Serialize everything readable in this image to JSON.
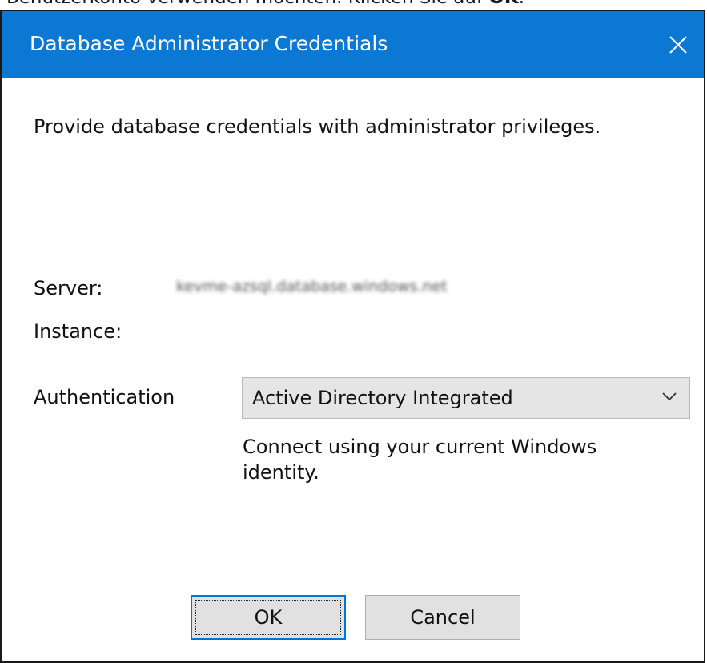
{
  "background_text": {
    "prefix": "Benutzerkonto verwenden möchten. Klicken Sie auf ",
    "bold": "OK",
    "suffix": "."
  },
  "window": {
    "title": "Database Administrator Credentials",
    "accent_color": "#0b78d4",
    "close_icon": "close-icon"
  },
  "dialog": {
    "intro": "Provide database credentials with administrator privileges.",
    "server_label": "Server:",
    "server_value": "kevme-azsql.database.windows.net",
    "instance_label": "Instance:",
    "instance_value": "",
    "authentication_label": "Authentication",
    "authentication_selected": "Active Directory Integrated",
    "authentication_description": "Connect using your current Windows identity."
  },
  "buttons": {
    "ok": "OK",
    "cancel": "Cancel"
  }
}
